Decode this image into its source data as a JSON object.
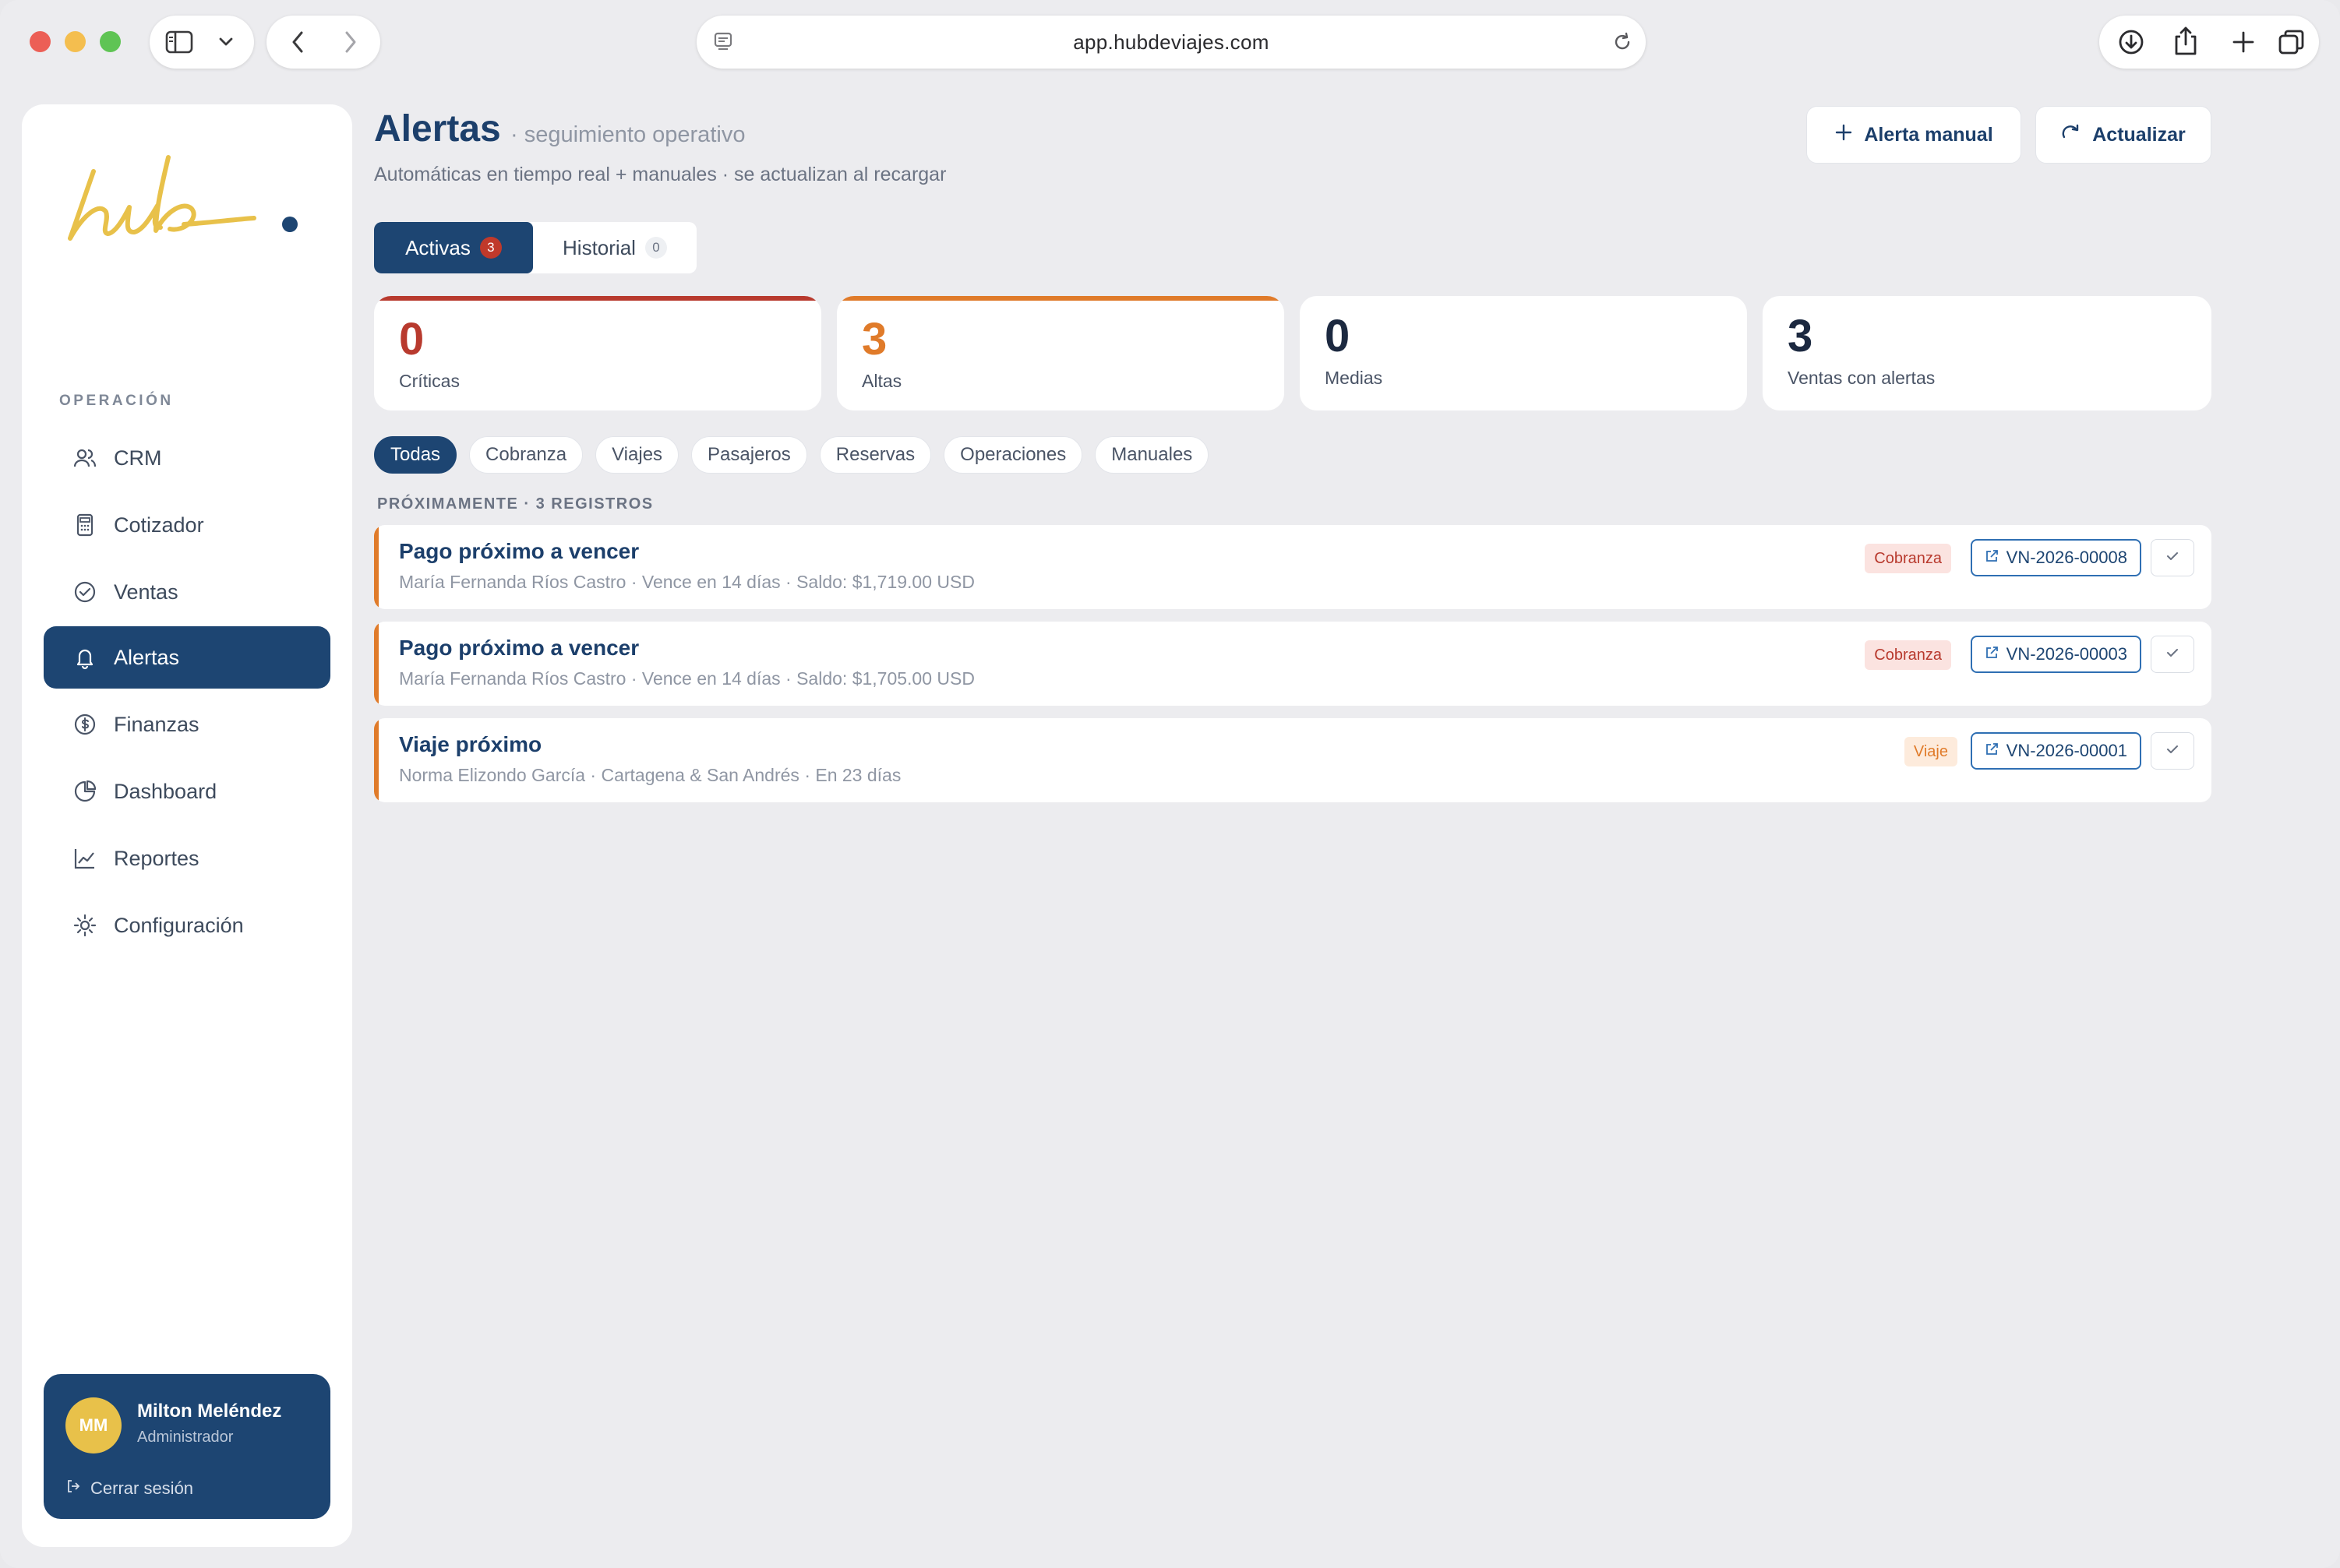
{
  "browser": {
    "url": "app.hubdeviajes.com"
  },
  "brand": {
    "logo_text": "hub",
    "colors": {
      "primary": "#1d4572",
      "accent_yellow": "#e8c14a",
      "critical": "#b83a2e",
      "high": "#e07b2a"
    }
  },
  "sidebar": {
    "section_label": "OPERACIÓN",
    "items": [
      {
        "label": "CRM",
        "icon": "users-icon",
        "active": false
      },
      {
        "label": "Cotizador",
        "icon": "calculator-icon",
        "active": false
      },
      {
        "label": "Ventas",
        "icon": "check-circle-icon",
        "active": false
      },
      {
        "label": "Alertas",
        "icon": "bell-icon",
        "active": true
      },
      {
        "label": "Finanzas",
        "icon": "dollar-circle-icon",
        "active": false
      },
      {
        "label": "Dashboard",
        "icon": "pie-chart-icon",
        "active": false
      },
      {
        "label": "Reportes",
        "icon": "line-chart-icon",
        "active": false
      },
      {
        "label": "Configuración",
        "icon": "gear-icon",
        "active": false
      }
    ],
    "user": {
      "initials": "MM",
      "name": "Milton Meléndez",
      "role": "Administrador",
      "logout_label": "Cerrar sesión"
    }
  },
  "header": {
    "title": "Alertas",
    "subtitle": "· seguimiento operativo",
    "description": "Automáticas en tiempo real + manuales · se actualizan al recargar",
    "manual_alert_label": "Alerta manual",
    "refresh_label": "Actualizar"
  },
  "tabs": [
    {
      "label": "Activas",
      "count": "3",
      "active": true
    },
    {
      "label": "Historial",
      "count": "0",
      "active": false
    }
  ],
  "stats": [
    {
      "value": "0",
      "label": "Críticas",
      "color": "#b83a2e",
      "bar": "#b83a2e"
    },
    {
      "value": "3",
      "label": "Altas",
      "color": "#e07b2a",
      "bar": "#e07b2a"
    },
    {
      "value": "0",
      "label": "Medias",
      "color": "#1c2940",
      "bar": ""
    },
    {
      "value": "3",
      "label": "Ventas con alertas",
      "color": "#1c2940",
      "bar": ""
    }
  ],
  "filters": [
    "Todas",
    "Cobranza",
    "Viajes",
    "Pasajeros",
    "Reservas",
    "Operaciones",
    "Manuales"
  ],
  "active_filter": "Todas",
  "list": {
    "label": "PRÓXIMAMENTE · 3 REGISTROS",
    "alerts": [
      {
        "title": "Pago próximo a vencer",
        "meta": "María Fernanda Ríos Castro · Vence en 14 días · Saldo: $1,719.00 USD",
        "tag": "Cobranza",
        "ref": "VN-2026-00008"
      },
      {
        "title": "Pago próximo a vencer",
        "meta": "María Fernanda Ríos Castro · Vence en 14 días · Saldo: $1,705.00 USD",
        "tag": "Cobranza",
        "ref": "VN-2026-00003"
      },
      {
        "title": "Viaje próximo",
        "meta": "Norma Elizondo García · Cartagena & San Andrés · En 23 días",
        "tag": "Viaje",
        "ref": "VN-2026-00001"
      }
    ]
  }
}
